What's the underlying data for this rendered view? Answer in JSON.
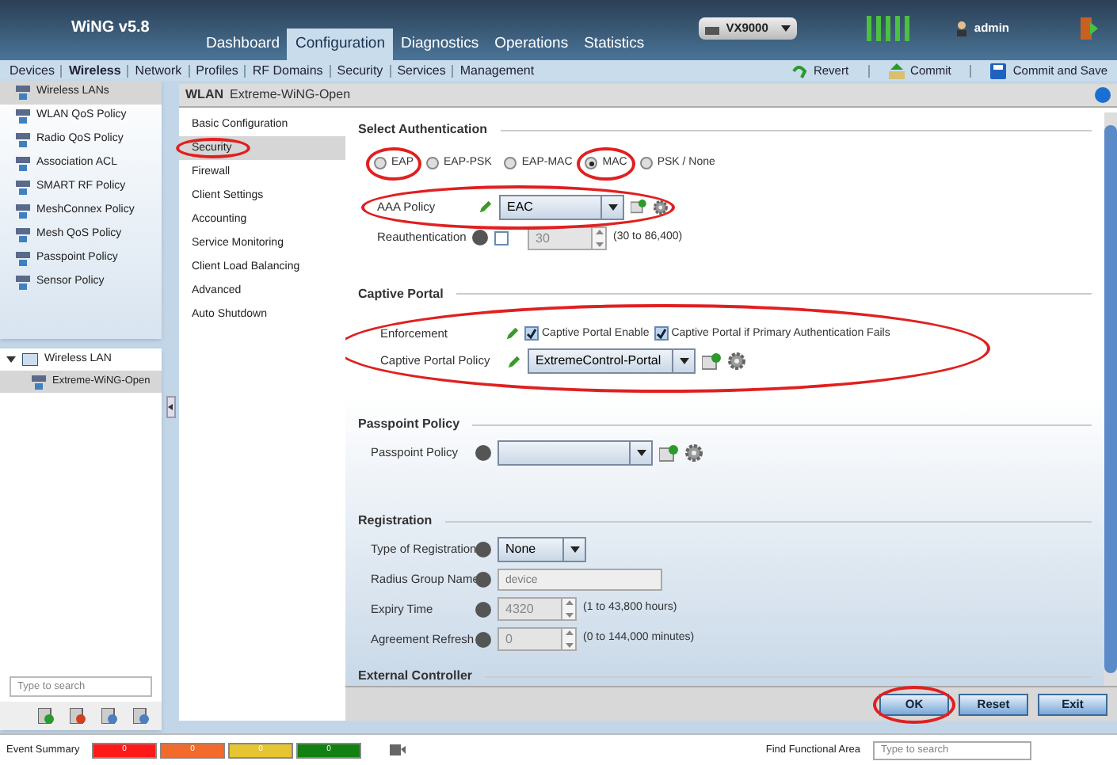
{
  "header": {
    "product": "WiNG v5.8",
    "tabs": [
      {
        "label": "Dashboard",
        "selected": false
      },
      {
        "label": "Configuration",
        "selected": true
      },
      {
        "label": "Diagnostics",
        "selected": false
      },
      {
        "label": "Operations",
        "selected": false
      },
      {
        "label": "Statistics",
        "selected": false
      }
    ],
    "device": "VX9000",
    "user": "admin"
  },
  "subnav": {
    "items": [
      {
        "label": "Devices",
        "selected": false
      },
      {
        "label": "Wireless",
        "selected": true
      },
      {
        "label": "Network",
        "selected": false
      },
      {
        "label": "Profiles",
        "selected": false
      },
      {
        "label": "RF Domains",
        "selected": false
      },
      {
        "label": "Security",
        "selected": false
      },
      {
        "label": "Services",
        "selected": false
      },
      {
        "label": "Management",
        "selected": false
      }
    ],
    "actions": [
      {
        "kind": "revert",
        "label": "Revert"
      },
      {
        "kind": "commit",
        "label": "Commit"
      },
      {
        "kind": "save",
        "label": "Commit and Save"
      }
    ]
  },
  "sidebar": {
    "items": [
      {
        "label": "Wireless LANs",
        "selected": true
      },
      {
        "label": "WLAN QoS Policy",
        "selected": false
      },
      {
        "label": "Radio QoS Policy",
        "selected": false
      },
      {
        "label": "Association ACL",
        "selected": false
      },
      {
        "label": "SMART RF Policy",
        "selected": false
      },
      {
        "label": "MeshConnex Policy",
        "selected": false
      },
      {
        "label": "Mesh QoS Policy",
        "selected": false
      },
      {
        "label": "Passpoint Policy",
        "selected": false
      },
      {
        "label": "Sensor Policy",
        "selected": false
      }
    ],
    "tree": [
      {
        "label": "Wireless LAN",
        "expanded": true,
        "children": [
          {
            "label": "Extreme-WiNG-Open",
            "selected": true
          }
        ]
      }
    ],
    "search_placeholder": "Type to search"
  },
  "panel": {
    "title": "WLAN",
    "name": "Extreme-WiNG-Open",
    "menu": [
      {
        "label": "Basic Configuration",
        "selected": false,
        "circled": false
      },
      {
        "label": "Security",
        "selected": true,
        "circled": true
      },
      {
        "label": "Firewall",
        "selected": false,
        "circled": false
      },
      {
        "label": "Client Settings",
        "selected": false,
        "circled": false
      },
      {
        "label": "Accounting",
        "selected": false,
        "circled": false
      },
      {
        "label": "Service Monitoring",
        "selected": false,
        "circled": false
      },
      {
        "label": "Client Load Balancing",
        "selected": false,
        "circled": false
      },
      {
        "label": "Advanced",
        "selected": false,
        "circled": false
      },
      {
        "label": "Auto Shutdown",
        "selected": false,
        "circled": false
      }
    ],
    "authentication": {
      "heading": "Select Authentication",
      "options": [
        {
          "label": "EAP",
          "selected": false,
          "circled": true
        },
        {
          "label": "EAP-PSK",
          "selected": false,
          "circled": false
        },
        {
          "label": "EAP-MAC",
          "selected": false,
          "circled": false
        },
        {
          "label": "MAC",
          "selected": true,
          "circled": true
        },
        {
          "label": "PSK / None",
          "selected": false,
          "circled": false
        }
      ],
      "aaa_policy": {
        "label": "AAA Policy",
        "value": "EAC",
        "circled": true
      },
      "reauthentication": {
        "label": "Reauthentication",
        "checked": false,
        "value": "30",
        "disabled": true,
        "range": "(30 to 86,400)"
      }
    },
    "captive_portal": {
      "heading": "Captive Portal",
      "circled": true,
      "enforcement_label": "Enforcement",
      "checks": [
        {
          "label": "Captive Portal Enable",
          "checked": true
        },
        {
          "label": "Captive Portal if Primary Authentication Fails",
          "checked": true
        }
      ],
      "policy_label": "Captive Portal Policy",
      "policy_value": "ExtremeControl-Portal"
    },
    "passpoint": {
      "heading": "Passpoint Policy",
      "label": "Passpoint Policy"
    },
    "registration": {
      "heading": "Registration",
      "type_label": "Type of Registration",
      "type_value": "None",
      "radius_label": "Radius Group Name",
      "radius_placeholder": "device",
      "expiry_label": "Expiry Time",
      "expiry_value": "4320",
      "expiry_disabled": true,
      "expiry_range": "(1 to 43,800 hours)",
      "refresh_label": "Agreement Refresh",
      "refresh_value": "0",
      "refresh_disabled": true,
      "refresh_range": "(0 to 144,000 minutes)"
    },
    "external_heading": "External Controller",
    "buttons": [
      {
        "label": "OK",
        "circled": true
      },
      {
        "label": "Reset",
        "circled": false
      },
      {
        "label": "Exit",
        "circled": false
      }
    ]
  },
  "status_bar": {
    "label": "Event Summary",
    "counts": [
      {
        "value": "0",
        "color": "#ff1a1a"
      },
      {
        "value": "0",
        "color": "#f26a2c"
      },
      {
        "value": "0",
        "color": "#e6c532"
      },
      {
        "value": "0",
        "color": "#128012"
      }
    ],
    "find_label": "Find Functional Area",
    "find_placeholder": "Type to search"
  }
}
